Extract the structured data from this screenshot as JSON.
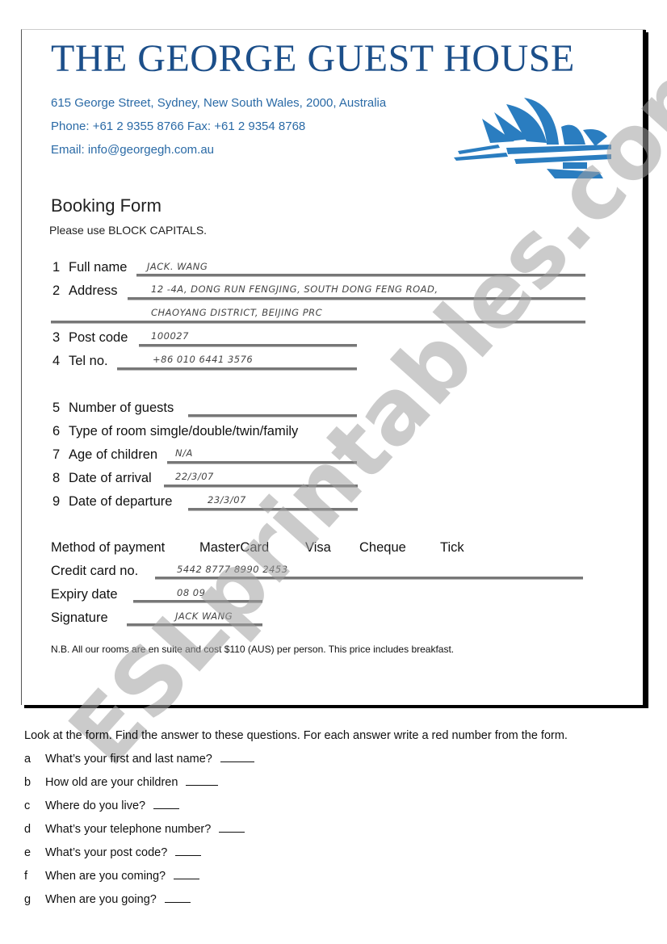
{
  "header": {
    "title": "THE GEORGE GUEST HOUSE",
    "address": "615 George Street, Sydney, New South Wales, 2000, Australia",
    "phone": "Phone: +61 2 9355 8766 Fax: +61 2 9354 8768",
    "email": "Email: info@georgegh.com.au",
    "logo_icon": "sydney-opera-house-icon",
    "brand_color": "#1c4f8a",
    "contact_color": "#2a6aa6"
  },
  "form": {
    "heading": "Booking Form",
    "instruction": "Please use BLOCK CAPITALS.",
    "fields": [
      {
        "num": "1",
        "label": "Full name",
        "value": "JACK. WANG"
      },
      {
        "num": "2",
        "label": "Address",
        "value": "12 -4A, DONG RUN FENGJING, SOUTH DONG FENG ROAD,",
        "value2": "CHAOYANG DISTRICT, BEIJING PRC"
      },
      {
        "num": "3",
        "label": "Post code",
        "value": "100027"
      },
      {
        "num": "4",
        "label": "Tel no.",
        "value": "+86 010 6441 3576"
      },
      {
        "num": "5",
        "label": "Number of guests",
        "value": ""
      },
      {
        "num": "6",
        "label": "Type of room simgle/double/twin/family",
        "value": ""
      },
      {
        "num": "7",
        "label": "Age of children",
        "value": "N/A"
      },
      {
        "num": "8",
        "label": "Date of arrival",
        "value": "22/3/07"
      },
      {
        "num": "9",
        "label": "Date of departure",
        "value": "23/3/07"
      }
    ],
    "payment": {
      "label": "Method of payment",
      "options": [
        "MasterCard",
        "Visa",
        "Cheque",
        "Tick"
      ],
      "card_label": "Credit card no.",
      "card_value": "5442 8777 8990 2453",
      "expiry_label": "Expiry date",
      "expiry_value": "08 09",
      "signature_label": "Signature",
      "signature_value": "JACK WANG"
    },
    "note": "N.B. All our rooms are en suite and cost $110 (AUS) per person. This price includes breakfast."
  },
  "watermark": "ESLprintables.com",
  "exercise": {
    "instruction": "Look at the form. Find the answer to these questions. For each answer write a red number from the form.",
    "questions": [
      {
        "letter": "a",
        "text": "What’s your first and last name?"
      },
      {
        "letter": "b",
        "text": "How old are your children"
      },
      {
        "letter": "c",
        "text": "Where do you live?"
      },
      {
        "letter": "d",
        "text": "What’s your telephone number?"
      },
      {
        "letter": "e",
        "text": "What’s your post code?"
      },
      {
        "letter": "f",
        "text": "When are you coming?"
      },
      {
        "letter": "g",
        "text": "When are you going?"
      }
    ]
  }
}
